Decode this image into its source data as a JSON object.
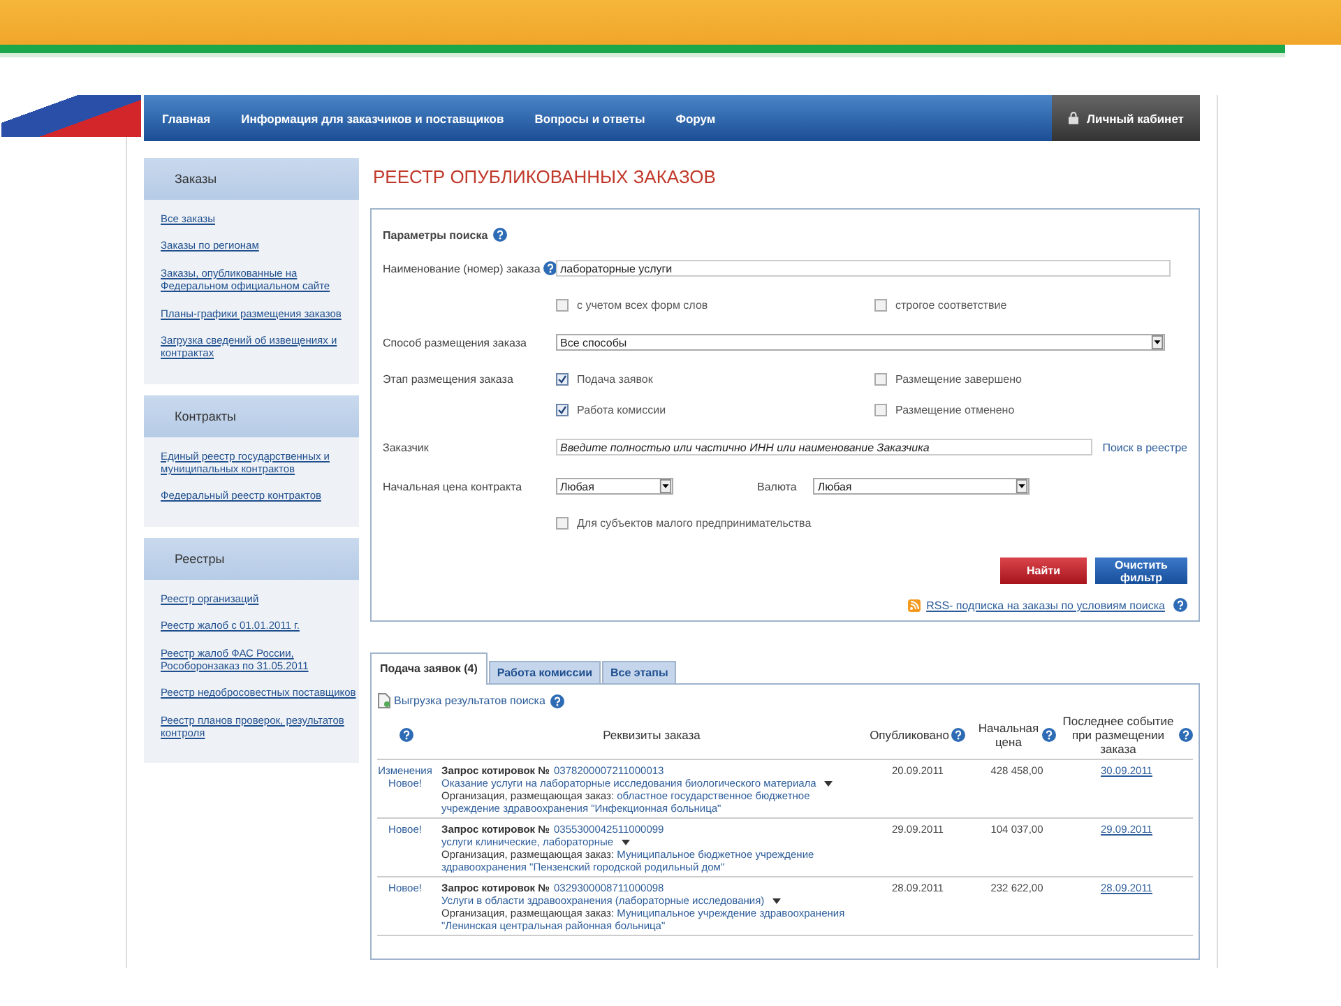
{
  "nav": {
    "items": [
      {
        "label": "Главная"
      },
      {
        "label": "Информация для заказчиков и поставщиков"
      },
      {
        "label": "Вопросы и ответы"
      },
      {
        "label": "Форум"
      }
    ],
    "account": "Личный кабинет"
  },
  "sidebar": [
    {
      "title": "Заказы",
      "links": [
        "Все заказы",
        "Заказы по регионам",
        "Заказы, опубликованные на Федеральном официальном сайте",
        "Планы-графики размещения заказов",
        "Загрузка сведений об извещениях и контрактах"
      ]
    },
    {
      "title": "Контракты",
      "links": [
        "Единый реестр государственных и муниципальных контрактов",
        "Федеральный реестр контрактов"
      ]
    },
    {
      "title": "Реестры",
      "links": [
        "Реестр организаций",
        "Реестр жалоб с 01.01.2011 г.",
        "Реестр жалоб ФАС России, Рособоронзаказ по 31.05.2011",
        "Реестр недобросовестных поставщиков",
        "Реестр планов проверок, результатов контроля"
      ]
    }
  ],
  "page_title": "РЕЕСТР ОПУБЛИКОВАННЫХ ЗАКАЗОВ",
  "search": {
    "title": "Параметры поиска",
    "name_label": "Наименование (номер) заказа",
    "name_value": "лабораторные услуги",
    "name_options": [
      {
        "label": "с учетом всех форм слов",
        "checked": false
      },
      {
        "label": "строгое соответствие",
        "checked": false
      }
    ],
    "method_label": "Способ размещения заказа",
    "method_value": "Все способы",
    "stage_label": "Этап размещения заказа",
    "stages": [
      {
        "label": "Подача заявок",
        "checked": true
      },
      {
        "label": "Размещение завершено",
        "checked": false
      },
      {
        "label": "Работа комиссии",
        "checked": true
      },
      {
        "label": "Размещение отменено",
        "checked": false
      }
    ],
    "customer_label": "Заказчик",
    "customer_placeholder": "Введите полностью или частично ИНН или наименование Заказчика",
    "registry_link": "Поиск в реестре",
    "price_label": "Начальная цена контракта",
    "price_value": "Любая",
    "currency_label": "Валюта",
    "currency_value": "Любая",
    "small_business": {
      "label": "Для субъектов малого предпринимательства",
      "checked": false
    },
    "find_button": "Найти",
    "clear_button": "Очистить фильтр",
    "rss_link": "RSS- подписка на заказы по условиям поиска"
  },
  "tabs": [
    {
      "label": "Подача заявок (4)",
      "selected": true
    },
    {
      "label": "Работа комиссии",
      "selected": false
    },
    {
      "label": "Все этапы",
      "selected": false
    }
  ],
  "export_link": "Выгрузка результатов поиска",
  "table": {
    "columns": [
      "Реквизиты заказа",
      "Опубликовано",
      "Начальная цена",
      "Последнее событие при размещении заказа"
    ],
    "rows": [
      {
        "status": [
          "Изменения",
          "Новое!"
        ],
        "title": "Запрос котировок №",
        "number": "0378200007211000013",
        "subject": "Оказание услуги на лабораторные исследования биологического материала",
        "org_label": "Организация, размещающая заказ:",
        "org": "областное государственное бюджетное учреждение здравоохранения \"Инфекционная больница\"",
        "published": "20.09.2011",
        "price": "428 458,00",
        "event": "30.09.2011"
      },
      {
        "status": [
          "Новое!"
        ],
        "title": "Запрос котировок №",
        "number": "0355300042511000099",
        "subject": "услуги клинические, лабораторные",
        "org_label": "Организация, размещающая заказ:",
        "org": "Муниципальное бюджетное учреждение здравоохранения \"Пензенский городской родильный дом\"",
        "published": "29.09.2011",
        "price": "104 037,00",
        "event": "29.09.2011"
      },
      {
        "status": [
          "Новое!"
        ],
        "title": "Запрос котировок №",
        "number": "0329300008711000098",
        "subject": "Услуги в области здравоохранения (лабораторные исследования)",
        "org_label": "Организация, размещающая заказ:",
        "org": "Муниципальное учреждение здравоохранения \"Ленинская центральная районная больница\"",
        "published": "28.09.2011",
        "price": "232 622,00",
        "event": "28.09.2011"
      }
    ]
  }
}
